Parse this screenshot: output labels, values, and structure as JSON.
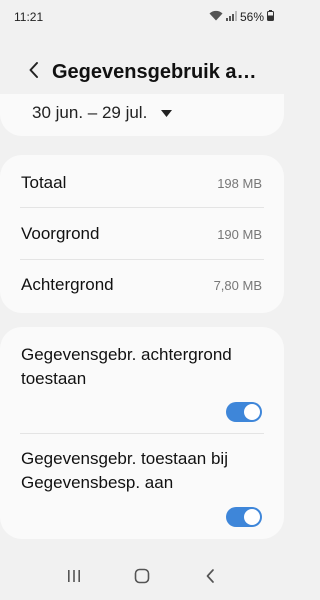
{
  "status_bar": {
    "time": "11:21",
    "battery": "56%",
    "icons": [
      "wifi-icon",
      "signal-icon",
      "battery-icon"
    ]
  },
  "header": {
    "title": "Gegevensgebruik a…",
    "back_icon": "chevron-left-icon"
  },
  "date_range": {
    "label": "30 jun. – 29 jul.",
    "dropdown_icon": "triangle-down-icon"
  },
  "usage": {
    "rows": [
      {
        "label": "Totaal",
        "value": "198 MB"
      },
      {
        "label": "Voorgrond",
        "value": "190 MB"
      },
      {
        "label": "Achtergrond",
        "value": "7,80 MB"
      }
    ]
  },
  "toggles": [
    {
      "label": "Gegevensgebr. achtergrond toestaan",
      "on": true
    },
    {
      "label": "Gegevensgebr. toestaan bij Gegevensbesp. aan",
      "on": true
    }
  ],
  "nav_bar": {
    "icons": [
      "recents-icon",
      "home-icon",
      "back-icon"
    ]
  },
  "colors": {
    "accent": "#3e86d9",
    "background": "#f1f1f1",
    "card": "#fafafa"
  }
}
